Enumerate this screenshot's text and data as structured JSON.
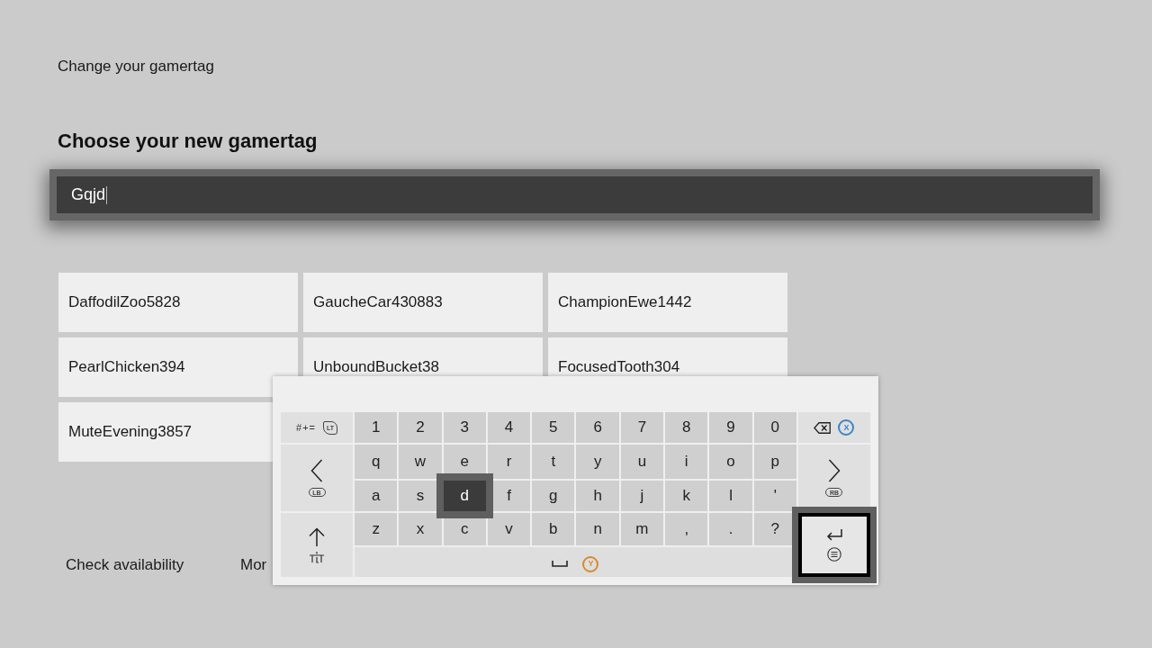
{
  "header": {
    "title": "Change your gamertag"
  },
  "prompt": {
    "heading": "Choose your new gamertag"
  },
  "gamertag_field": {
    "value": "Gqjd"
  },
  "suggestions": [
    {
      "label": "DaffodilZoo5828",
      "selected": false
    },
    {
      "label": "GaucheCar430883",
      "selected": false
    },
    {
      "label": "ChampionEwe1442",
      "selected": false
    },
    {
      "label": "PearlChicken394",
      "selected": false
    },
    {
      "label": "UnboundBucket38",
      "selected": false
    },
    {
      "label": "FocusedTooth304",
      "selected": false
    },
    {
      "label": "MuteEvening3857",
      "selected": false
    }
  ],
  "actions": [
    {
      "label": "Check availability"
    },
    {
      "label": "Mor"
    }
  ],
  "keyboard": {
    "left_keys": [
      {
        "kind": "symbols",
        "label": "#+=",
        "hint": {
          "kind": "trigger",
          "label": "LT"
        },
        "selected": false,
        "highlighted": false
      },
      {
        "kind": "previous",
        "hint": {
          "kind": "bumper",
          "label": "LB"
        },
        "selected": false,
        "highlighted": false
      },
      {
        "kind": "shift",
        "selected": false,
        "highlighted": false
      }
    ],
    "rows": [
      [
        {
          "label": "1",
          "selected": false
        },
        {
          "label": "2",
          "selected": false
        },
        {
          "label": "3",
          "selected": false
        },
        {
          "label": "4",
          "selected": false
        },
        {
          "label": "5",
          "selected": false
        },
        {
          "label": "6",
          "selected": false
        },
        {
          "label": "7",
          "selected": false
        },
        {
          "label": "8",
          "selected": false
        },
        {
          "label": "9",
          "selected": false
        },
        {
          "label": "0",
          "selected": false
        }
      ],
      [
        {
          "label": "q",
          "selected": false
        },
        {
          "label": "w",
          "selected": false
        },
        {
          "label": "e",
          "selected": false
        },
        {
          "label": "r",
          "selected": false
        },
        {
          "label": "t",
          "selected": false
        },
        {
          "label": "y",
          "selected": false
        },
        {
          "label": "u",
          "selected": false
        },
        {
          "label": "i",
          "selected": false
        },
        {
          "label": "o",
          "selected": false
        },
        {
          "label": "p",
          "selected": false
        }
      ],
      [
        {
          "label": "a",
          "selected": false
        },
        {
          "label": "s",
          "selected": false
        },
        {
          "label": "d",
          "selected": true
        },
        {
          "label": "f",
          "selected": false
        },
        {
          "label": "g",
          "selected": false
        },
        {
          "label": "h",
          "selected": false
        },
        {
          "label": "j",
          "selected": false
        },
        {
          "label": "k",
          "selected": false
        },
        {
          "label": "l",
          "selected": false
        },
        {
          "label": "'",
          "selected": false
        }
      ],
      [
        {
          "label": "z",
          "selected": false
        },
        {
          "label": "x",
          "selected": false
        },
        {
          "label": "c",
          "selected": false
        },
        {
          "label": "v",
          "selected": false
        },
        {
          "label": "b",
          "selected": false
        },
        {
          "label": "n",
          "selected": false
        },
        {
          "label": "m",
          "selected": false
        },
        {
          "label": ",",
          "selected": false
        },
        {
          "label": ".",
          "selected": false
        },
        {
          "label": "?",
          "selected": false
        }
      ]
    ],
    "space_key": {
      "hint": {
        "kind": "face",
        "label": "Y",
        "color": "#d68a2e"
      },
      "selected": false
    },
    "right_keys": [
      {
        "kind": "backspace",
        "hint": {
          "kind": "face",
          "label": "X",
          "color": "#3a84c6"
        },
        "selected": false,
        "highlighted": false
      },
      {
        "kind": "next",
        "hint": {
          "kind": "bumper",
          "label": "RB"
        },
        "selected": false,
        "highlighted": false
      },
      {
        "kind": "enter",
        "selected": false,
        "highlighted": true
      }
    ]
  }
}
